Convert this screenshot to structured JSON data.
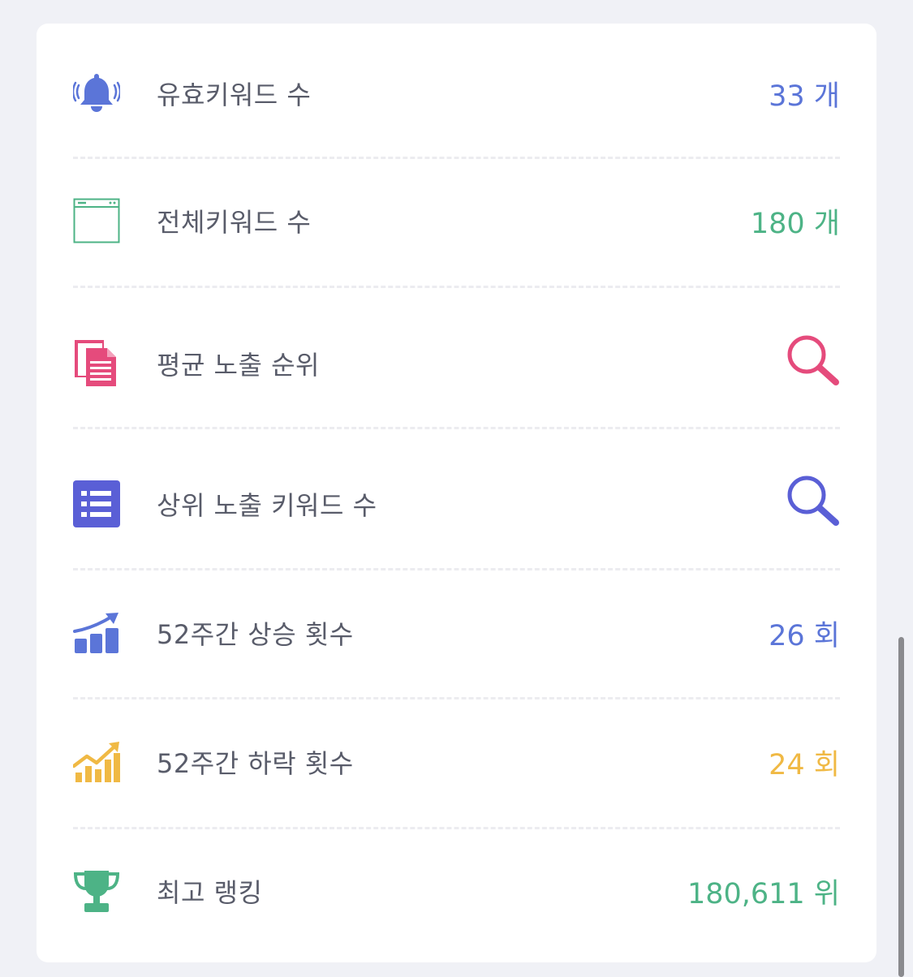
{
  "colors": {
    "blue": "#5b75d8",
    "green": "#4db386",
    "pink": "#e54b7c",
    "indigo": "#5a5fd6",
    "yellow": "#f0b944",
    "label": "#595c6a"
  },
  "rows": [
    {
      "icon": "bell-icon",
      "label": "유효키워드 수",
      "value": "33 개",
      "color": "blue"
    },
    {
      "icon": "browser-window-icon",
      "label": "전체키워드 수",
      "value": "180 개",
      "color": "green"
    },
    {
      "icon": "documents-icon",
      "label": "평균 노출 순위",
      "value_icon": "search-icon",
      "color": "pink"
    },
    {
      "icon": "list-icon",
      "label": "상위 노출 키워드 수",
      "value_icon": "search-icon",
      "color": "indigo"
    },
    {
      "icon": "chart-rising-icon",
      "label": "52주간 상승 횟수",
      "value": "26 회",
      "color": "blue"
    },
    {
      "icon": "chart-rising-icon",
      "label": "52주간 하락 횟수",
      "value": "24 회",
      "color": "yellow"
    },
    {
      "icon": "trophy-icon",
      "label": "최고 랭킹",
      "value": "180,611 위",
      "color": "green"
    }
  ]
}
